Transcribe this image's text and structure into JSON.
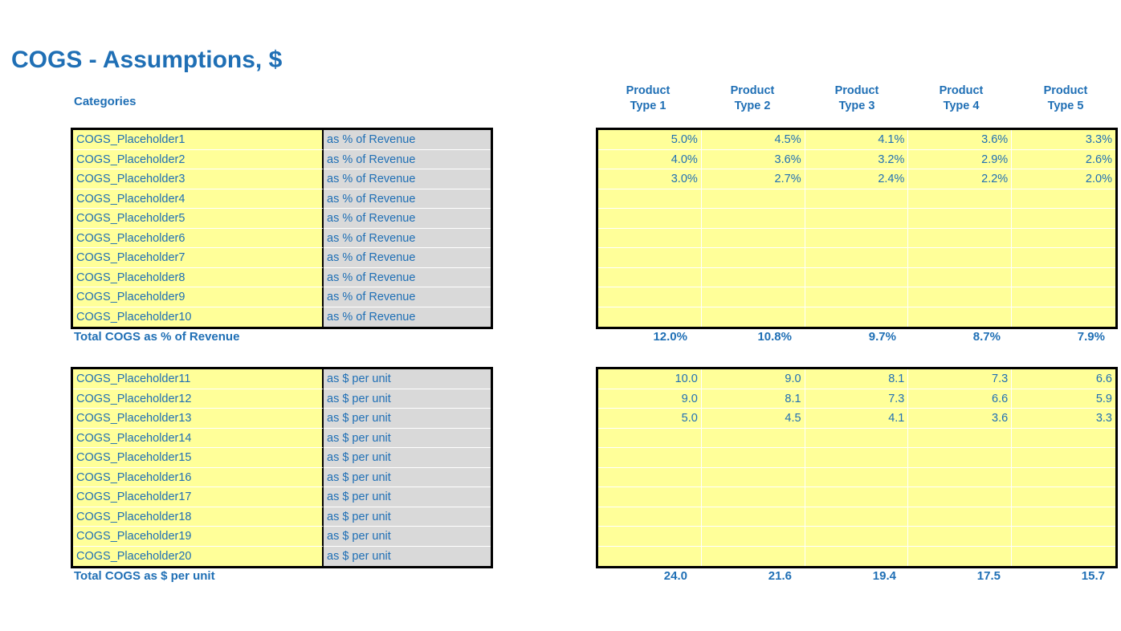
{
  "title": "COGS - Assumptions, $",
  "categories_label": "Categories",
  "column_headers": [
    {
      "line1": "Product",
      "line2": "Type 1"
    },
    {
      "line1": "Product",
      "line2": "Type 2"
    },
    {
      "line1": "Product",
      "line2": "Type 3"
    },
    {
      "line1": "Product",
      "line2": "Type 4"
    },
    {
      "line1": "Product",
      "line2": "Type 5"
    }
  ],
  "colors": {
    "accent_blue": "#1F6FB5",
    "input_yellow": "#FFFF99",
    "unit_gray": "#D9D9D9",
    "border_black": "#000000"
  },
  "section_percent": {
    "rows": [
      {
        "name": "COGS_Placeholder1",
        "unit": "as % of Revenue",
        "values": [
          "5.0%",
          "4.5%",
          "4.1%",
          "3.6%",
          "3.3%"
        ]
      },
      {
        "name": "COGS_Placeholder2",
        "unit": "as % of Revenue",
        "values": [
          "4.0%",
          "3.6%",
          "3.2%",
          "2.9%",
          "2.6%"
        ]
      },
      {
        "name": "COGS_Placeholder3",
        "unit": "as % of Revenue",
        "values": [
          "3.0%",
          "2.7%",
          "2.4%",
          "2.2%",
          "2.0%"
        ]
      },
      {
        "name": "COGS_Placeholder4",
        "unit": "as % of Revenue",
        "values": [
          "",
          "",
          "",
          "",
          ""
        ]
      },
      {
        "name": "COGS_Placeholder5",
        "unit": "as % of Revenue",
        "values": [
          "",
          "",
          "",
          "",
          ""
        ]
      },
      {
        "name": "COGS_Placeholder6",
        "unit": "as % of Revenue",
        "values": [
          "",
          "",
          "",
          "",
          ""
        ]
      },
      {
        "name": "COGS_Placeholder7",
        "unit": "as % of Revenue",
        "values": [
          "",
          "",
          "",
          "",
          ""
        ]
      },
      {
        "name": "COGS_Placeholder8",
        "unit": "as % of Revenue",
        "values": [
          "",
          "",
          "",
          "",
          ""
        ]
      },
      {
        "name": "COGS_Placeholder9",
        "unit": "as % of Revenue",
        "values": [
          "",
          "",
          "",
          "",
          ""
        ]
      },
      {
        "name": "COGS_Placeholder10",
        "unit": "as % of Revenue",
        "values": [
          "",
          "",
          "",
          "",
          ""
        ]
      }
    ],
    "total_label": "Total COGS as % of Revenue",
    "total_values": [
      "12.0%",
      "10.8%",
      "9.7%",
      "8.7%",
      "7.9%"
    ]
  },
  "section_per_unit": {
    "rows": [
      {
        "name": "COGS_Placeholder11",
        "unit": "as $ per unit",
        "values": [
          "10.0",
          "9.0",
          "8.1",
          "7.3",
          "6.6"
        ]
      },
      {
        "name": "COGS_Placeholder12",
        "unit": "as $ per unit",
        "values": [
          "9.0",
          "8.1",
          "7.3",
          "6.6",
          "5.9"
        ]
      },
      {
        "name": "COGS_Placeholder13",
        "unit": "as $ per unit",
        "values": [
          "5.0",
          "4.5",
          "4.1",
          "3.6",
          "3.3"
        ]
      },
      {
        "name": "COGS_Placeholder14",
        "unit": "as $ per unit",
        "values": [
          "",
          "",
          "",
          "",
          ""
        ]
      },
      {
        "name": "COGS_Placeholder15",
        "unit": "as $ per unit",
        "values": [
          "",
          "",
          "",
          "",
          ""
        ]
      },
      {
        "name": "COGS_Placeholder16",
        "unit": "as $ per unit",
        "values": [
          "",
          "",
          "",
          "",
          ""
        ]
      },
      {
        "name": "COGS_Placeholder17",
        "unit": "as $ per unit",
        "values": [
          "",
          "",
          "",
          "",
          ""
        ]
      },
      {
        "name": "COGS_Placeholder18",
        "unit": "as $ per unit",
        "values": [
          "",
          "",
          "",
          "",
          ""
        ]
      },
      {
        "name": "COGS_Placeholder19",
        "unit": "as $ per unit",
        "values": [
          "",
          "",
          "",
          "",
          ""
        ]
      },
      {
        "name": "COGS_Placeholder20",
        "unit": "as $ per unit",
        "values": [
          "",
          "",
          "",
          "",
          ""
        ]
      }
    ],
    "total_label": "Total COGS as $ per unit",
    "total_values": [
      "24.0",
      "21.6",
      "19.4",
      "17.5",
      "15.7"
    ]
  }
}
